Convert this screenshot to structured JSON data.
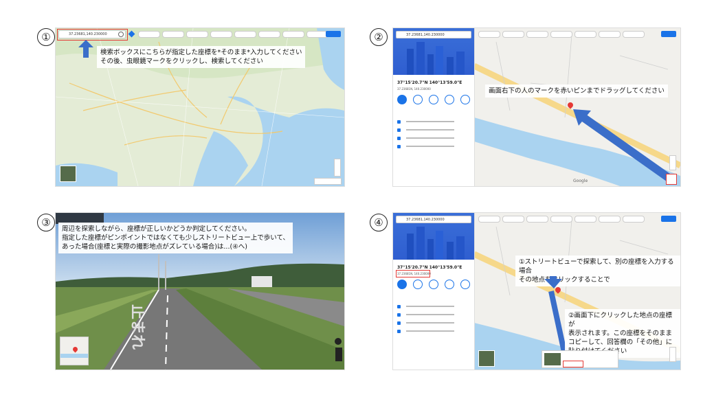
{
  "step1": {
    "number": "①",
    "search_value": "37.23681,140.230000",
    "chips": [
      "",
      "",
      "",
      "",
      "",
      "",
      "",
      "",
      ""
    ],
    "caption_lines": [
      "検索ボックスにこちらが指定した座標を*そのまま*入力してください",
      "その後、虫眼鏡マークをクリックし、検索してください"
    ]
  },
  "step2": {
    "number": "②",
    "search_value": "37.23681,140.230000",
    "coord_title": "37°15'20.7\"N 140°13'59.0\"E",
    "coord_sub": "37.23681N, 140.230000",
    "caption": "画面右下の人のマークを赤いピンまでドラッグしてください",
    "map_brand": "Google"
  },
  "step3": {
    "number": "③",
    "caption_lines": [
      "周辺を探索しながら、座標が正しいかどうか判定してください。",
      "指定した座標がピンポイントではなくても少しストリートビュー上で歩いて、",
      "あった場合(座標と実際の撮影地点がズレている場合)は...(④へ)"
    ],
    "road_text": "止まれ"
  },
  "step4": {
    "number": "④",
    "search_value": "37.23681,140.230000",
    "coord_title": "37°15'20.7\"N 140°13'59.0\"E",
    "coord_sub": "37.23681N, 140.230000",
    "caption_a_lines": [
      "①ストリートビューで探索して、別の座標を入力する場合",
      "その地点をクリックすることで"
    ],
    "caption_b_lines": [
      "②画面下にクリックした地点の座標が",
      "表示されます。この座標をそのまま",
      "コピーして、回答欄の「その他」に",
      "貼り付けてください"
    ]
  },
  "colors": {
    "accent_blue": "#3b6ec9",
    "highlight_red": "#e53935",
    "map_green": "#d8e8c8",
    "water": "#aad3f0"
  }
}
